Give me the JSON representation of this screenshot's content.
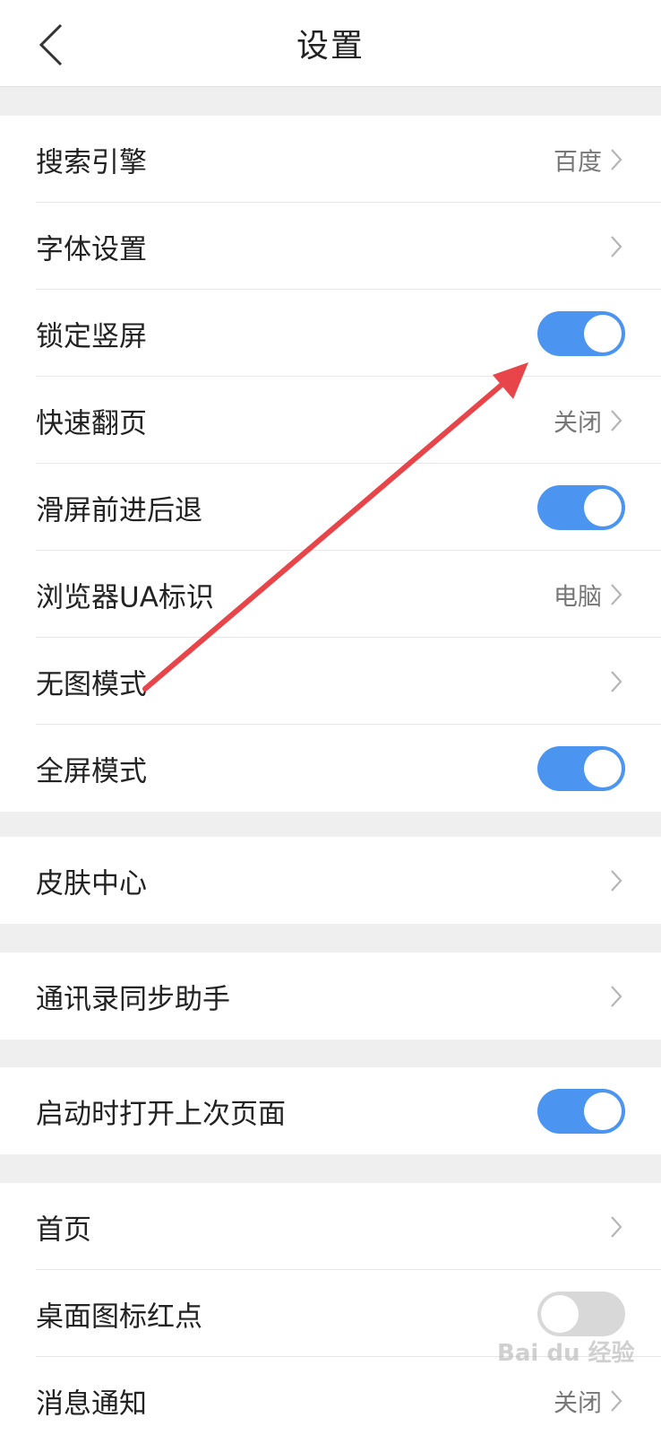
{
  "header": {
    "title": "设置"
  },
  "groups": [
    {
      "items": [
        {
          "label": "搜索引擎",
          "value": "百度",
          "control": "chevron"
        },
        {
          "label": "字体设置",
          "value": "",
          "control": "chevron"
        },
        {
          "label": "锁定竖屏",
          "control": "toggle",
          "state": "on"
        },
        {
          "label": "快速翻页",
          "value": "关闭",
          "control": "chevron"
        },
        {
          "label": "滑屏前进后退",
          "control": "toggle",
          "state": "on"
        },
        {
          "label": "浏览器UA标识",
          "value": "电脑",
          "control": "chevron"
        },
        {
          "label": "无图模式",
          "value": "",
          "control": "chevron"
        },
        {
          "label": "全屏模式",
          "control": "toggle",
          "state": "on"
        }
      ]
    },
    {
      "items": [
        {
          "label": "皮肤中心",
          "value": "",
          "control": "chevron"
        }
      ]
    },
    {
      "items": [
        {
          "label": "通讯录同步助手",
          "value": "",
          "control": "chevron"
        }
      ]
    },
    {
      "items": [
        {
          "label": "启动时打开上次页面",
          "control": "toggle",
          "state": "on"
        }
      ]
    },
    {
      "items": [
        {
          "label": "首页",
          "value": "",
          "control": "chevron"
        },
        {
          "label": "桌面图标红点",
          "control": "toggle",
          "state": "off"
        },
        {
          "label": "消息通知",
          "value": "关闭",
          "control": "chevron"
        }
      ]
    }
  ],
  "watermark": {
    "text": "Bai du 经验"
  },
  "colors": {
    "toggle_on": "#4b95f0",
    "toggle_off": "#d8d8d8",
    "arrow": "#e8454a",
    "page_bg": "#efefef"
  }
}
